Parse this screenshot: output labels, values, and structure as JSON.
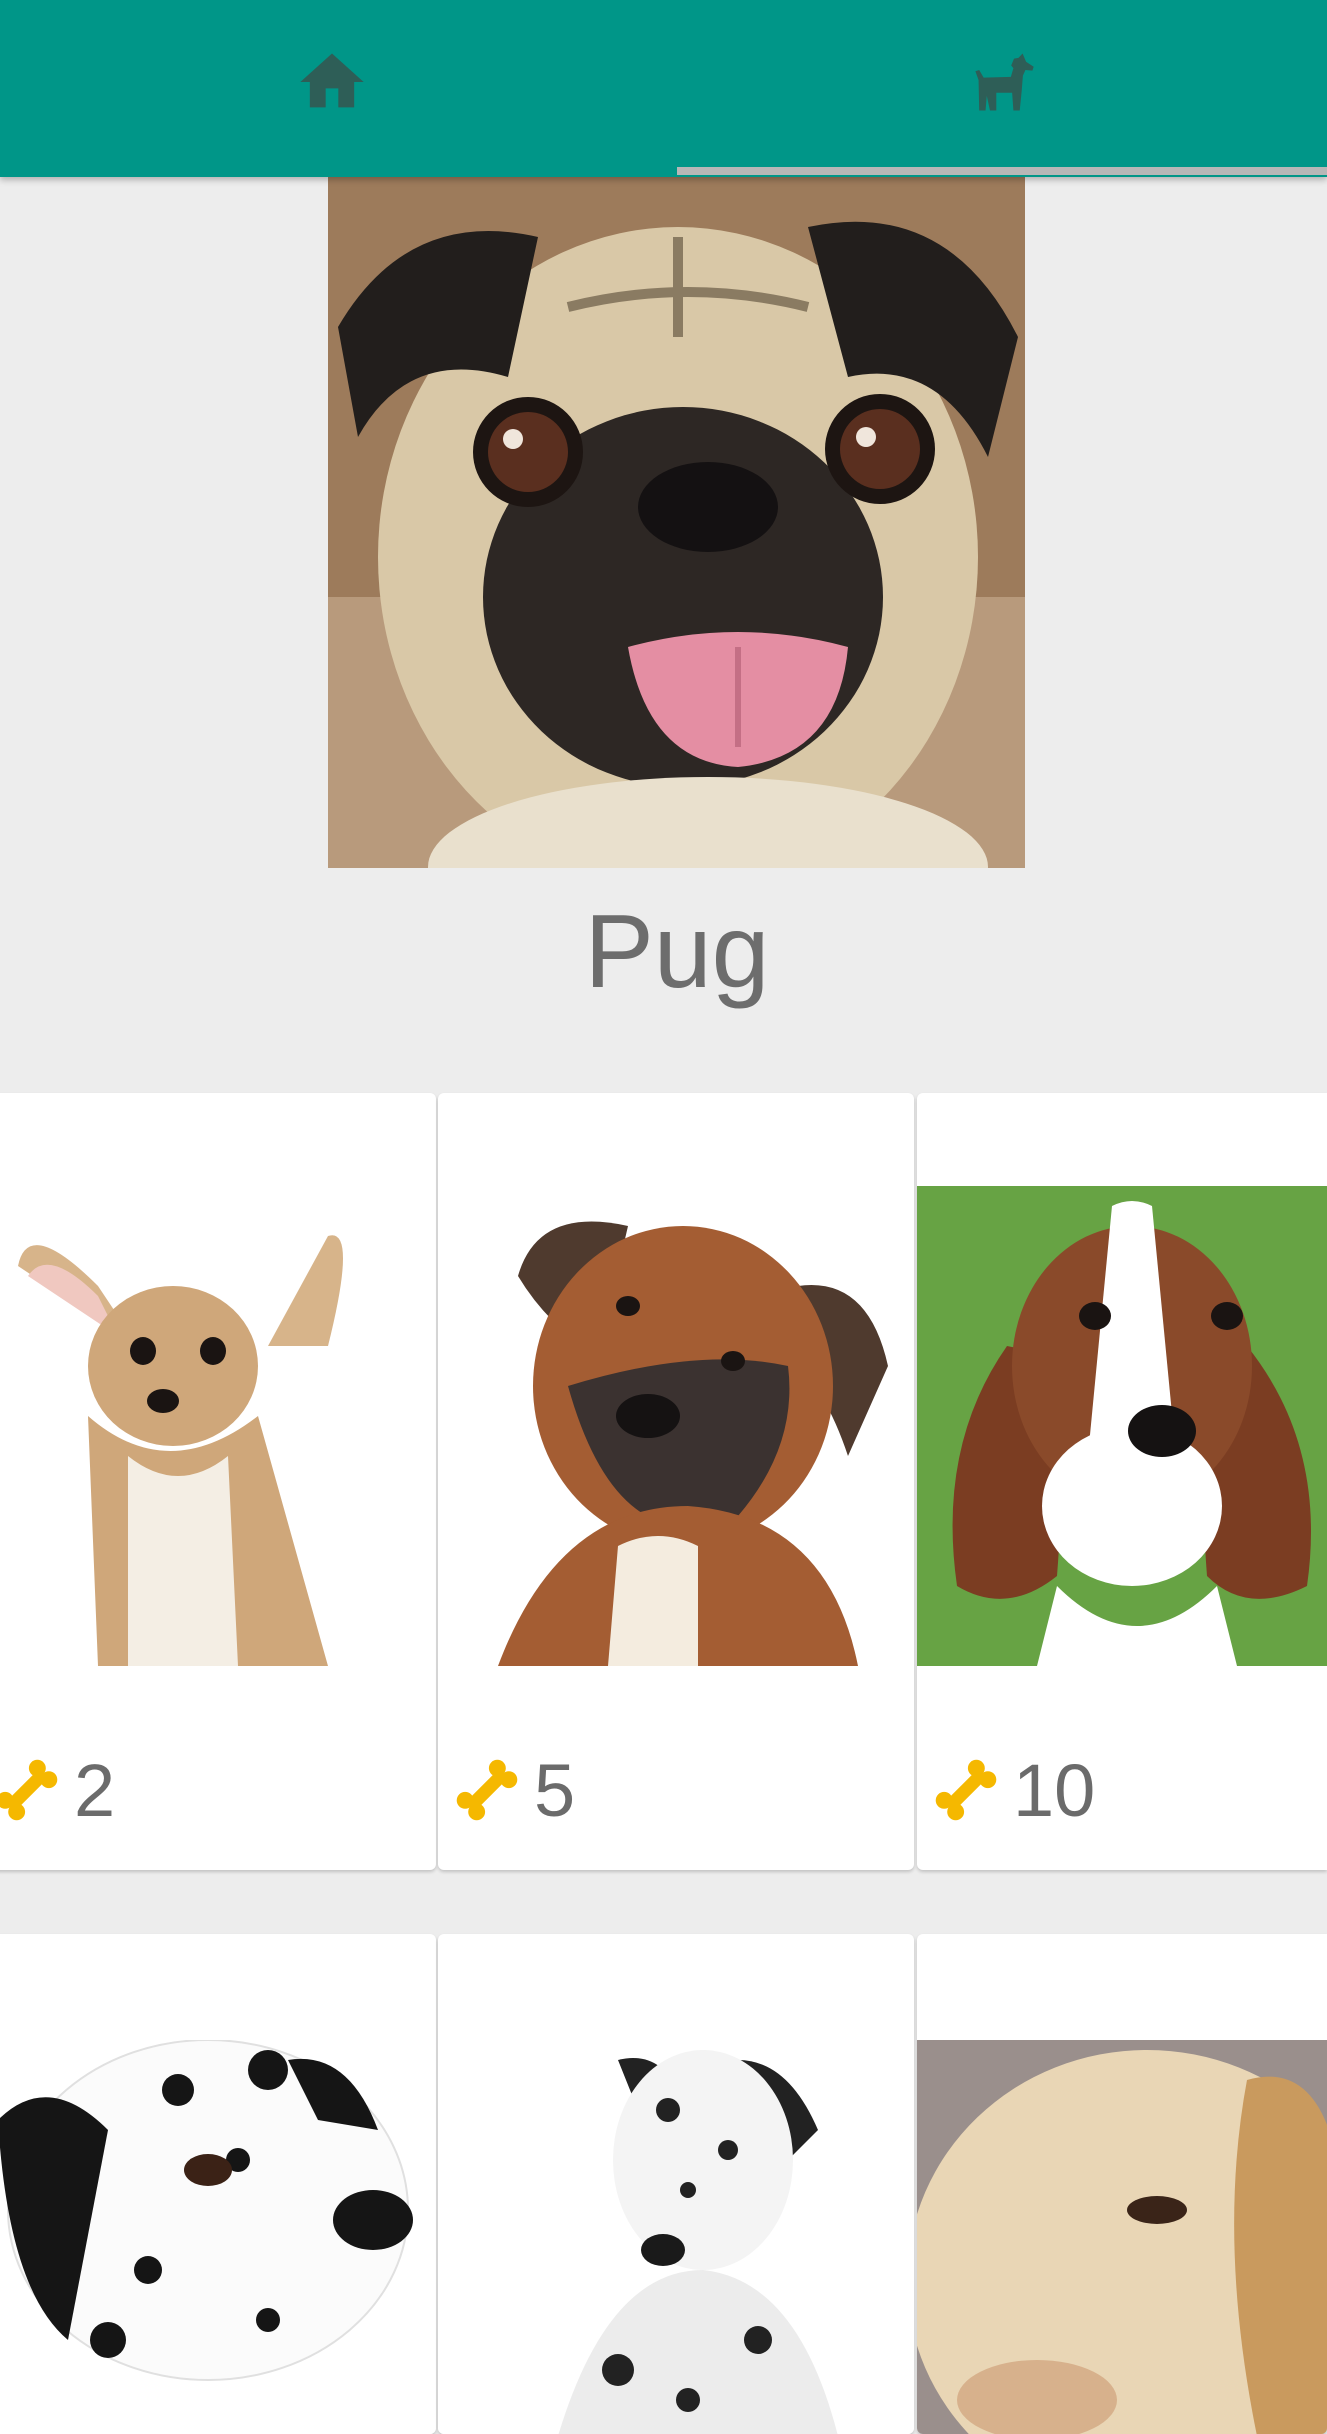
{
  "tabs": [
    {
      "icon": "home-icon",
      "selected": false
    },
    {
      "icon": "dog-icon",
      "selected": true
    }
  ],
  "colors": {
    "tabbar": "#009688",
    "tab_icon": "#2e5e57",
    "indicator": "#b7b7b7",
    "background": "#ededed",
    "card": "#ffffff",
    "text": "#6d6d6d",
    "bone": "#f5b800"
  },
  "featured": {
    "name": "Pug",
    "image": "pug-photo"
  },
  "dogs": [
    {
      "image": "chihuahua-photo",
      "price": "2"
    },
    {
      "image": "boxer-photo",
      "price": "5"
    },
    {
      "image": "basset-hound-photo",
      "price": "10"
    },
    {
      "image": "dalmatian-photo"
    },
    {
      "image": "great-dane-photo"
    },
    {
      "image": "labrador-photo"
    }
  ]
}
